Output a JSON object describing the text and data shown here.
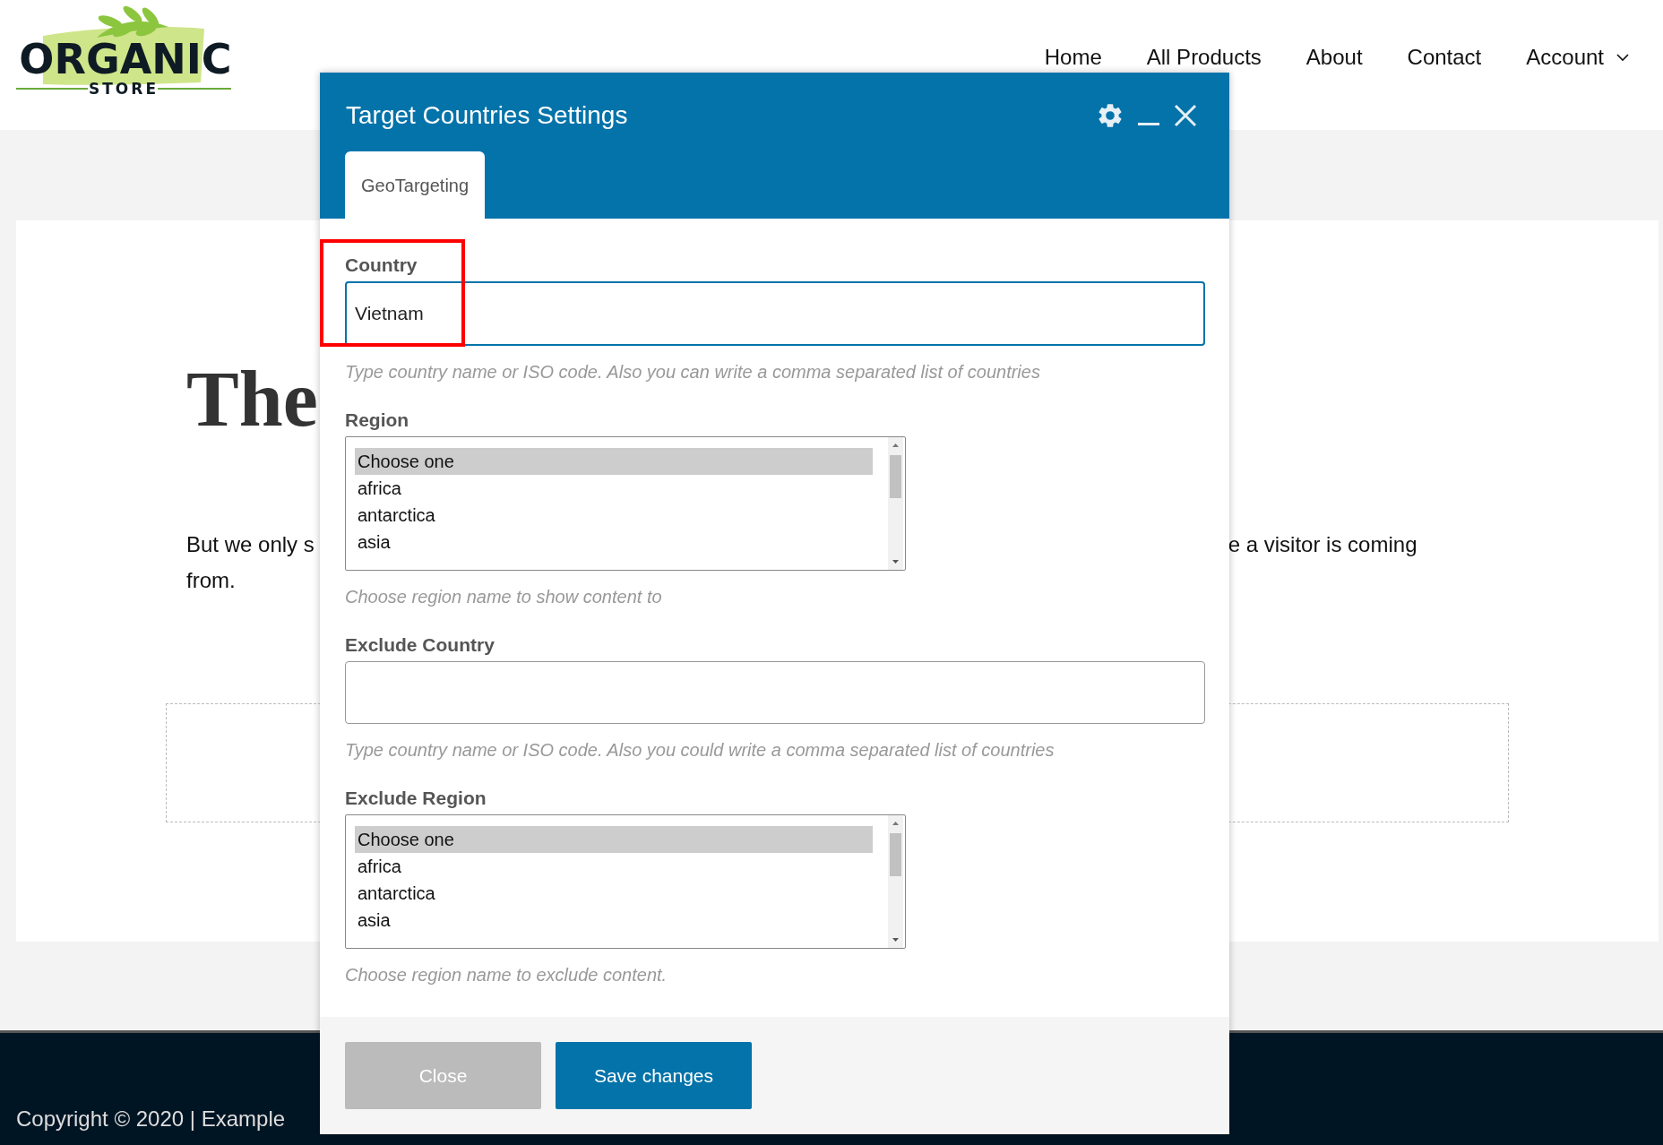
{
  "logo": {
    "title": "ORGANIC",
    "subtitle": "STORE"
  },
  "nav": [
    {
      "label": "Home",
      "dropdown": false
    },
    {
      "label": "All Products",
      "dropdown": false
    },
    {
      "label": "About",
      "dropdown": false
    },
    {
      "label": "Contact",
      "dropdown": false
    },
    {
      "label": "Account",
      "dropdown": true
    }
  ],
  "content": {
    "heading": "The",
    "paragraph_left": "But we only s",
    "paragraph_right": "e a visitor is coming",
    "paragraph_end": "from."
  },
  "footer": {
    "copyright": "Copyright © 2020 | Example"
  },
  "modal": {
    "title": "Target Countries Settings",
    "tabs": [
      {
        "label": "GeoTargeting",
        "selected": true
      }
    ],
    "fields": [
      {
        "kind": "text",
        "label": "Country",
        "value": "Vietnam",
        "focused": true,
        "help": "Type country name or ISO code. Also you can write a comma separated list of countries"
      },
      {
        "kind": "listbox",
        "label": "Region",
        "options": [
          {
            "label": "Choose one",
            "selected": true
          },
          {
            "label": "africa",
            "selected": false
          },
          {
            "label": "antarctica",
            "selected": false
          },
          {
            "label": "asia",
            "selected": false
          }
        ],
        "help": "Choose region name to show content to"
      },
      {
        "kind": "text",
        "label": "Exclude Country",
        "focused": false,
        "help": "Type country name or ISO code. Also you could write a comma separated list of countries"
      },
      {
        "kind": "listbox",
        "label": "Exclude Region",
        "options": [
          {
            "label": "Choose one",
            "selected": true
          },
          {
            "label": "africa",
            "selected": false
          },
          {
            "label": "antarctica",
            "selected": false
          },
          {
            "label": "asia",
            "selected": false
          }
        ],
        "help": "Choose region name to exclude content."
      }
    ],
    "buttons": [
      {
        "kind": "secondary",
        "label": "Close"
      },
      {
        "kind": "primary",
        "label": "Save changes"
      }
    ]
  }
}
